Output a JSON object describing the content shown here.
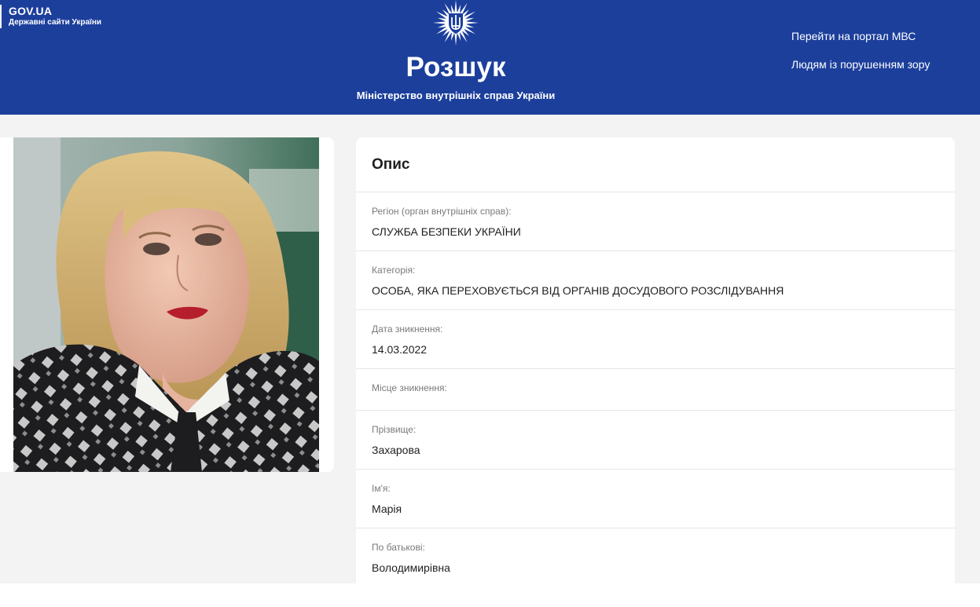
{
  "header": {
    "gov_title": "GOV.UA",
    "gov_subtitle": "Державні сайти України",
    "site_title": "Розшук",
    "site_subtitle": "Міністерство внутрішніх справ України",
    "link_portal": "Перейти на портал МВС",
    "link_accessibility": "Людям із порушенням зору",
    "emblem_icon": "police-star-trident-icon",
    "color": "#1c3f9c"
  },
  "photo": {
    "icon": "person-photo"
  },
  "description": {
    "title": "Опис",
    "fields": [
      {
        "label": "Регіон (орган внутрішніх справ):",
        "value": "СЛУЖБА БЕЗПЕКИ УКРАЇНИ"
      },
      {
        "label": "Категорія:",
        "value": "ОСОБА, ЯКА ПЕРЕХОВУЄТЬСЯ ВІД ОРГАНІВ ДОСУДОВОГО РОЗСЛІДУВАННЯ"
      },
      {
        "label": "Дата зникнення:",
        "value": "14.03.2022"
      },
      {
        "label": "Місце зникнення:",
        "value": ""
      },
      {
        "label": "Прізвище:",
        "value": "Захарова"
      },
      {
        "label": "Ім'я:",
        "value": "Марія"
      },
      {
        "label": "По батькові:",
        "value": "Володимирівна"
      }
    ]
  }
}
